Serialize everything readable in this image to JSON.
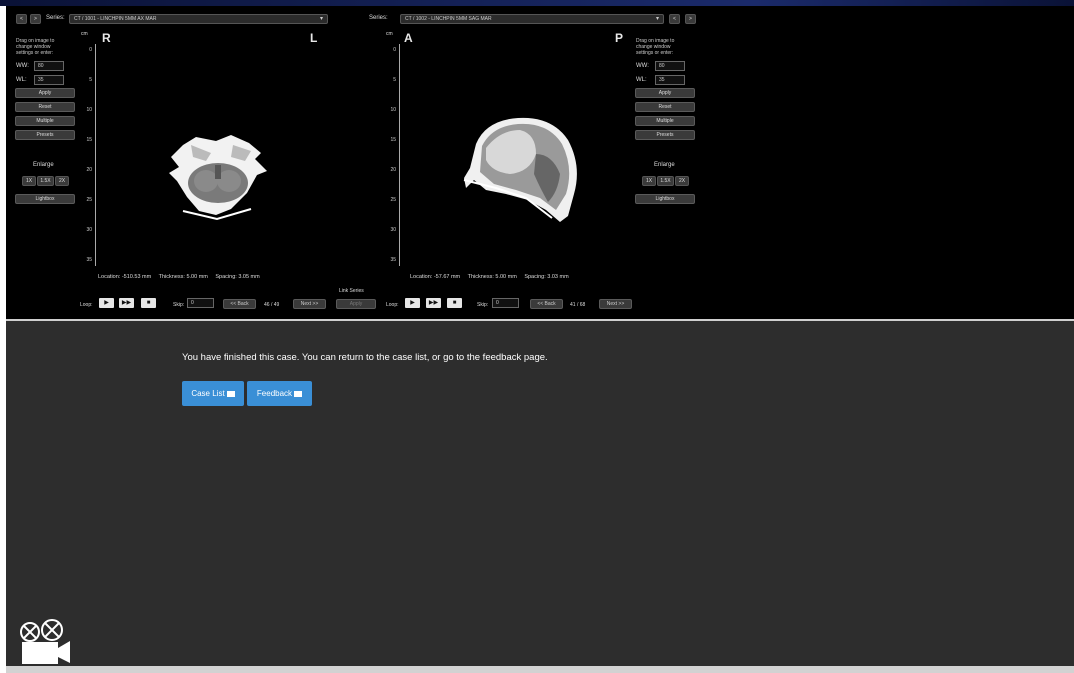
{
  "left_viewer": {
    "series_label": "Series:",
    "series_value": "CT / 1001 - LINCHPIN 5MM AX MAR",
    "prev": "<",
    "next": ">",
    "orient_left": "R",
    "orient_right": "L",
    "ruler_unit": "cm",
    "ruler_labels": [
      "0",
      "5",
      "10",
      "15",
      "20",
      "25",
      "30",
      "35"
    ],
    "location": "Location:   -510.53 mm",
    "thickness": "Thickness:   5.00 mm",
    "spacing": "Spacing:   3.05 mm",
    "loop_label": "Loop:",
    "skip_label": "Skip:",
    "skip_value": "0",
    "back": "<< Back",
    "counter": "46 / 49",
    "forward": "Next >>"
  },
  "right_viewer": {
    "series_label": "Series:",
    "series_value": "CT / 1002 - LINCHPIN 5MM SAG MAR",
    "prev": "<",
    "next": ">",
    "orient_left": "A",
    "orient_right": "P",
    "ruler_unit": "cm",
    "ruler_labels": [
      "0",
      "5",
      "10",
      "15",
      "20",
      "25",
      "30",
      "35"
    ],
    "location": "Location:   -57.67 mm",
    "thickness": "Thickness:   5.00 mm",
    "spacing": "Spacing:   3.03 mm",
    "loop_label": "Loop:",
    "skip_label": "Skip:",
    "skip_value": "0",
    "back": "<< Back",
    "counter": "41 / 68",
    "forward": "Next >>"
  },
  "link_series": {
    "label": "Link Series",
    "button": "Apply"
  },
  "left_panel": {
    "help": "Drag on image to change window settings or enter:",
    "ww_label": "WW:",
    "ww_value": "80",
    "wl_label": "WL:",
    "wl_value": "35",
    "apply": "Apply",
    "reset": "Reset",
    "multiple": "Multiple",
    "presets": "Presets",
    "enlarge": "Enlarge",
    "zoom": [
      "1X",
      "1.5X",
      "2X"
    ],
    "lightbox": "Lightbox"
  },
  "right_panel": {
    "help": "Drag on image to change window settings or enter:",
    "ww_label": "WW:",
    "ww_value": "80",
    "wl_label": "WL:",
    "wl_value": "35",
    "apply": "Apply",
    "reset": "Reset",
    "multiple": "Multiple",
    "presets": "Presets",
    "enlarge": "Enlarge",
    "zoom": [
      "1X",
      "1.5X",
      "2X"
    ],
    "lightbox": "Lightbox"
  },
  "finish": {
    "message": "You have finished this case. You can return to the case list, or go to the feedback page.",
    "case_list": "Case List",
    "feedback": "Feedback"
  },
  "colors": {
    "viewer_bg": "#000000",
    "panel_bg": "#2d2d2d",
    "accent": "#3a8fd6"
  },
  "icons": [
    "camera-icon",
    "play-icon",
    "fast-forward-icon",
    "stop-icon"
  ]
}
